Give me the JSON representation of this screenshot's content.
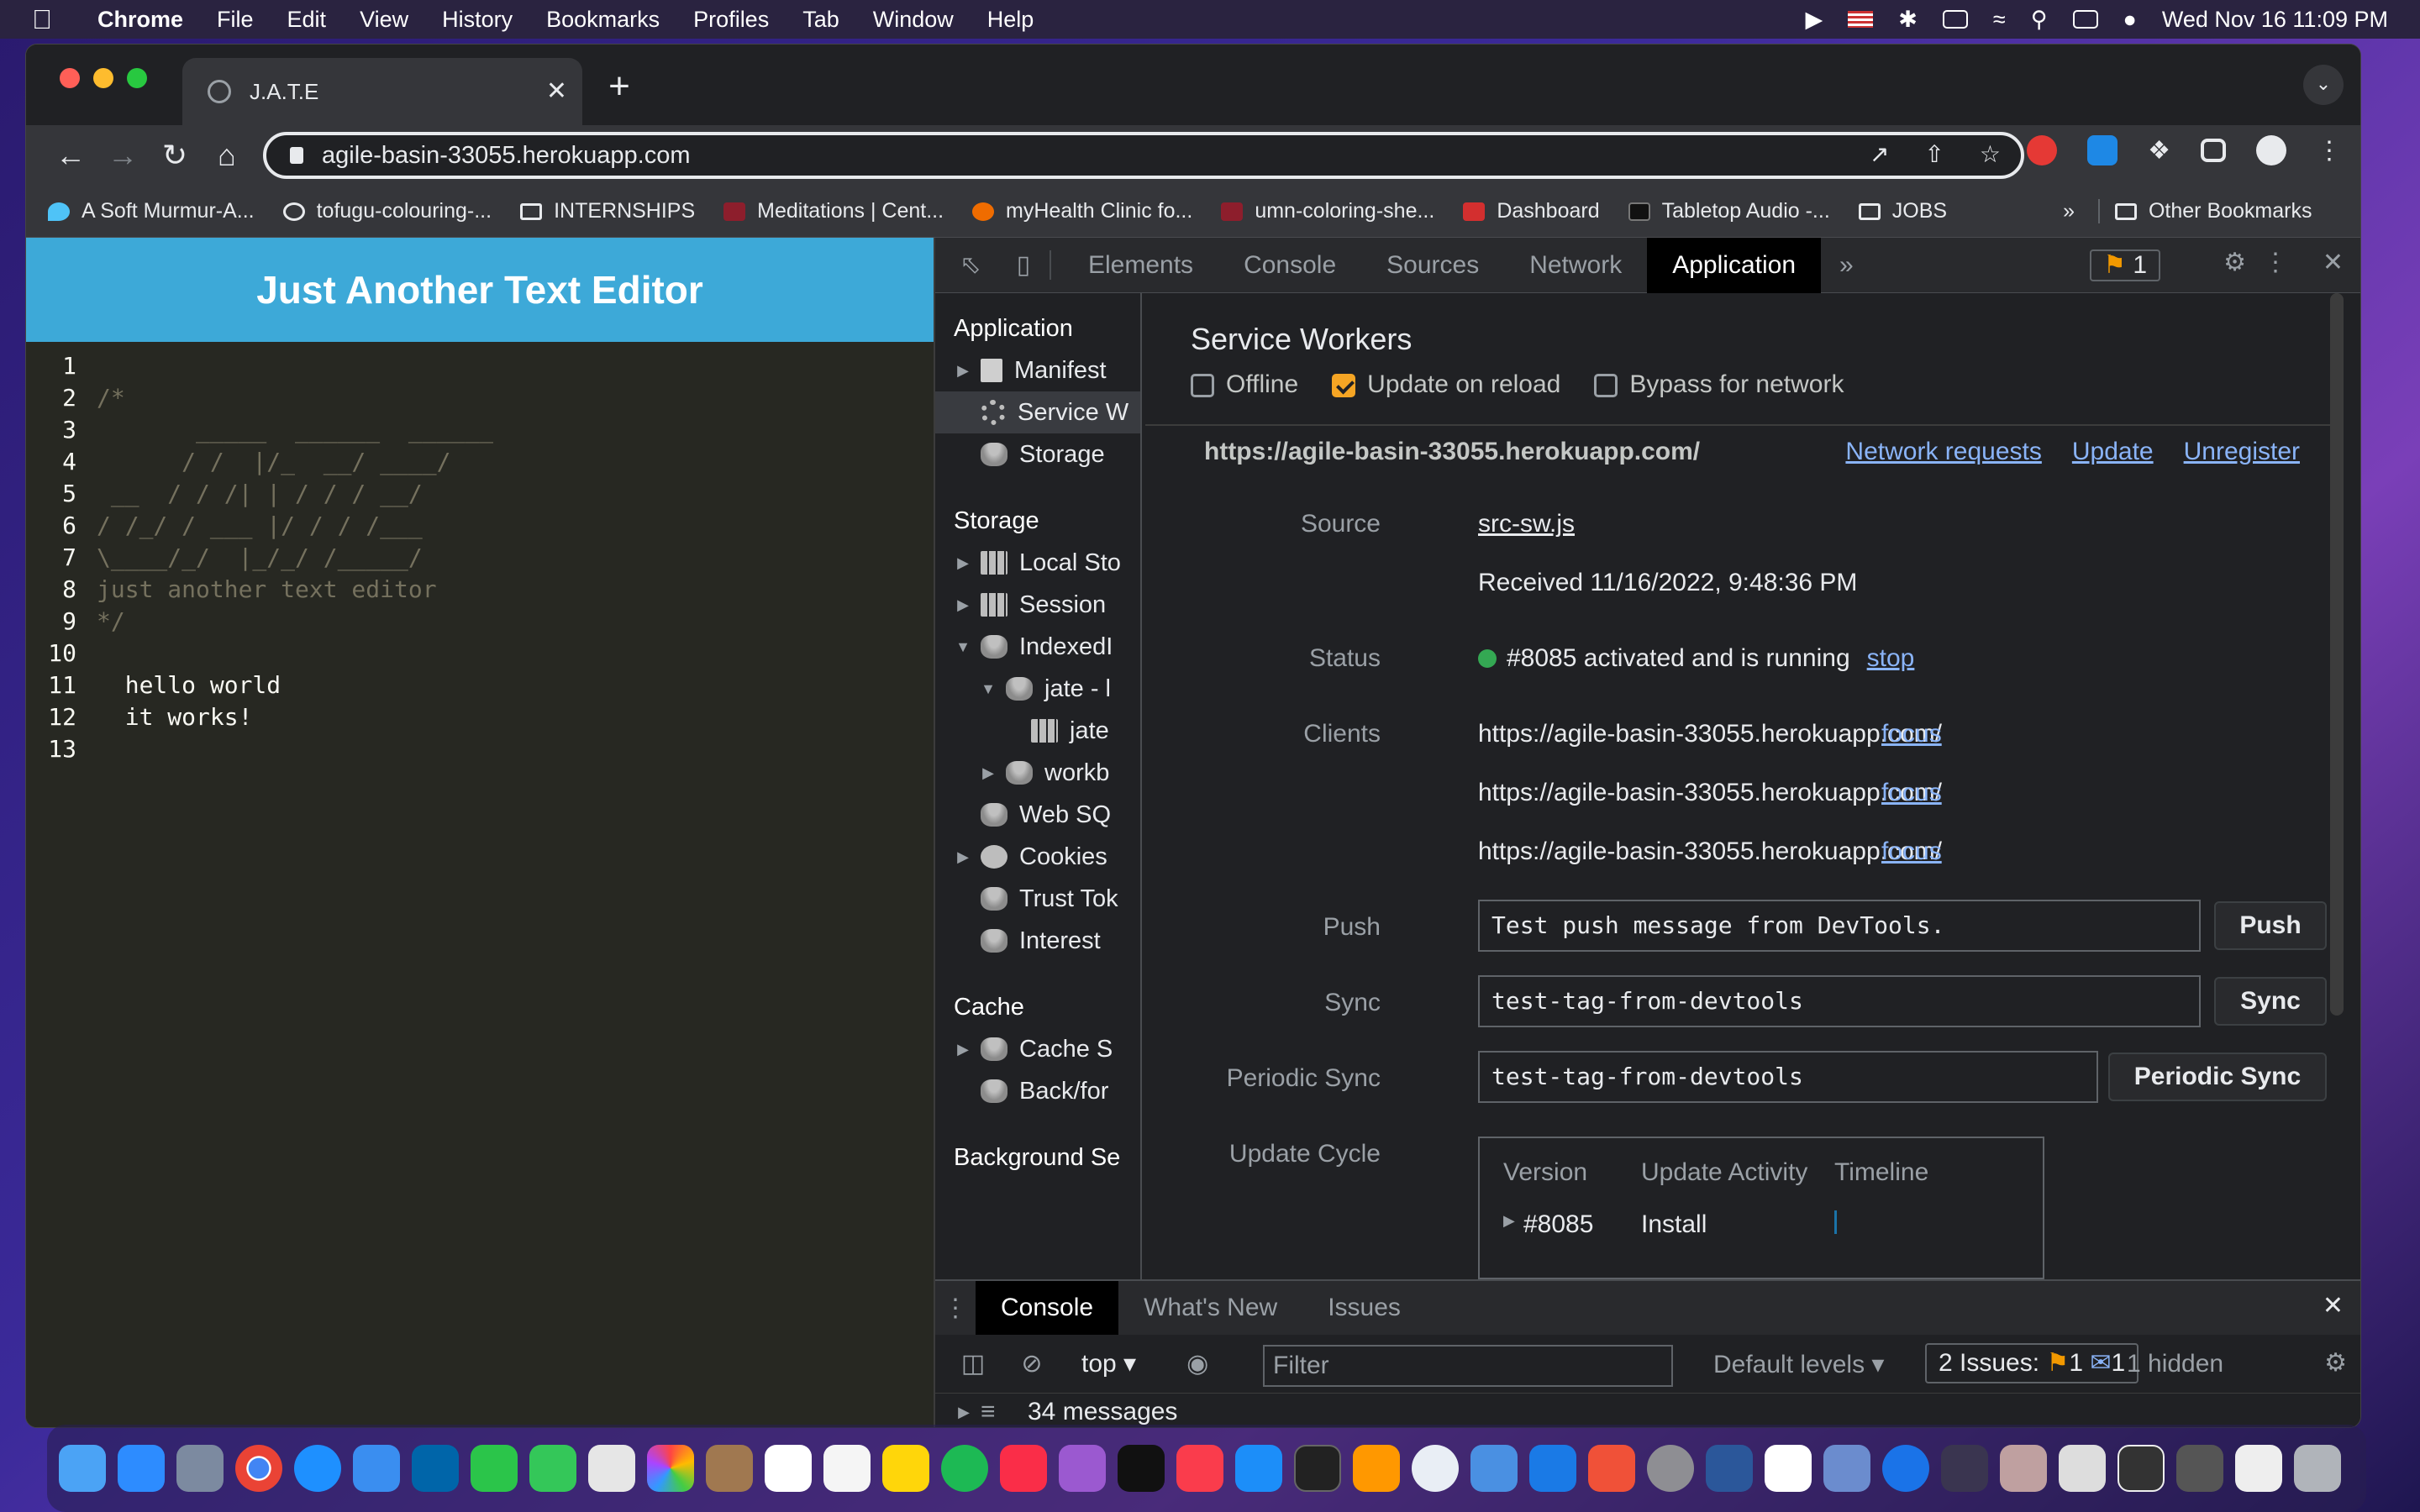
{
  "menubar": {
    "app": "Chrome",
    "items": [
      "File",
      "Edit",
      "View",
      "History",
      "Bookmarks",
      "Profiles",
      "Tab",
      "Window",
      "Help"
    ],
    "clock": "Wed Nov 16  11:09 PM"
  },
  "browser": {
    "tab_title": "J.A.T.E",
    "url": "agile-basin-33055.herokuapp.com",
    "bookmarks": [
      "A Soft Murmur-A...",
      "tofugu-colouring-...",
      "INTERNSHIPS",
      "Meditations | Cent...",
      "myHealth Clinic fo...",
      "umn-coloring-she...",
      "Dashboard",
      "Tabletop Audio -...",
      "JOBS"
    ],
    "bookmarks_overflow": "»",
    "other_bookmarks": "Other Bookmarks"
  },
  "page": {
    "header": "Just Another Text Editor",
    "lines": [
      {
        "n": "1",
        "t": "",
        "cls": "c"
      },
      {
        "n": "2",
        "t": "/*",
        "cls": "c"
      },
      {
        "n": "3",
        "t": "       _____  ______  ______",
        "cls": "c"
      },
      {
        "n": "4",
        "t": "      / /  |/_  __/ ____/",
        "cls": "c"
      },
      {
        "n": "5",
        "t": " __  / / /| | / / / __/",
        "cls": "c"
      },
      {
        "n": "6",
        "t": "/ /_/ / ___ |/ / / /___",
        "cls": "c"
      },
      {
        "n": "7",
        "t": "\\____/_/  |_/_/ /_____/",
        "cls": "c"
      },
      {
        "n": "8",
        "t": "just another text editor",
        "cls": "c"
      },
      {
        "n": "9",
        "t": "*/",
        "cls": "c"
      },
      {
        "n": "10",
        "t": "",
        "cls": "c"
      },
      {
        "n": "11",
        "t": "  hello world",
        "cls": "c w"
      },
      {
        "n": "12",
        "t": "  it works!",
        "cls": "c w"
      },
      {
        "n": "13",
        "t": "",
        "cls": "c"
      }
    ]
  },
  "devtools": {
    "tabs": [
      "Elements",
      "Console",
      "Sources",
      "Network",
      "Application"
    ],
    "more": "»",
    "issues_badge": "1",
    "sidebar": {
      "application_header": "Application",
      "application_items": [
        "Manifest",
        "Service W",
        "Storage"
      ],
      "storage_header": "Storage",
      "storage_items": [
        "Local Sto",
        "Session",
        "IndexedI",
        "jate - l",
        "jate",
        "workb",
        "Web SQ",
        "Cookies",
        "Trust Tok",
        "Interest"
      ],
      "cache_header": "Cache",
      "cache_items": [
        "Cache S",
        "Back/for"
      ],
      "background_header": "Background Se"
    },
    "sw": {
      "title": "Service Workers",
      "offline": "Offline",
      "update_on_reload": "Update on reload",
      "bypass": "Bypass for network",
      "origin": "https://agile-basin-33055.herokuapp.com/",
      "link_network": "Network requests",
      "link_update": "Update",
      "link_unregister": "Unregister",
      "source_label": "Source",
      "source_link": "src-sw.js",
      "received": "Received 11/16/2022, 9:48:36 PM",
      "status_label": "Status",
      "status_text": "#8085 activated and is running",
      "stop": "stop",
      "clients_label": "Clients",
      "client_url": "https://agile-basin-33055.herokuapp.com/",
      "focus": "focus",
      "push_label": "Push",
      "push_value": "Test push message from DevTools.",
      "push_btn": "Push",
      "sync_label": "Sync",
      "sync_value": "test-tag-from-devtools",
      "sync_btn": "Sync",
      "psync_label": "Periodic Sync",
      "psync_value": "test-tag-from-devtools",
      "psync_btn": "Periodic Sync",
      "uc_label": "Update Cycle",
      "uc_cols": [
        "Version",
        "Update Activity",
        "Timeline"
      ],
      "uc_version": "#8085",
      "uc_activity": "Install"
    },
    "drawer": {
      "tabs": [
        "Console",
        "What's New",
        "Issues"
      ],
      "context": "top",
      "filter_placeholder": "Filter",
      "levels": "Default levels",
      "issues_text": "2 Issues:",
      "issues_warn": "1",
      "issues_info": "1",
      "hidden": "1 hidden",
      "messages": "34 messages"
    }
  },
  "colors": {
    "accent": "#3da9d8",
    "editor_bg": "#272822",
    "link": "#8ab4f8",
    "status_green": "#34a853"
  }
}
